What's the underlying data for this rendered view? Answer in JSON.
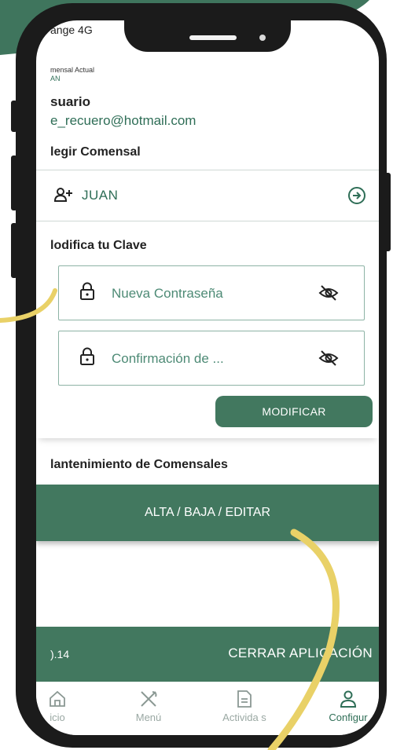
{
  "status": {
    "carrier": "ange  4G"
  },
  "header": {
    "comensal_actual_label": "mensal Actual",
    "comensal_actual_value": "AN"
  },
  "usuario": {
    "label": "suario",
    "email": "e_recuero@hotmail.com"
  },
  "elegir": {
    "title": "legir Comensal",
    "selected": "JUAN"
  },
  "clave": {
    "title": "lodifica tu Clave",
    "new_password_placeholder": "Nueva Contraseña",
    "confirm_placeholder": "Confirmación de ...",
    "modify_button": "MODIFICAR"
  },
  "mantenimiento": {
    "title": "lantenimiento de Comensales",
    "button": "ALTA / BAJA / EDITAR"
  },
  "footer": {
    "version": ").14",
    "close_button": "CERRAR APLICACIÓN"
  },
  "tabs": [
    {
      "label": "icio",
      "icon": "home-icon"
    },
    {
      "label": "Menú",
      "icon": "utensils-icon"
    },
    {
      "label": "Activida   s",
      "icon": "document-icon"
    },
    {
      "label": "Configur",
      "icon": "user-icon",
      "active": true
    }
  ],
  "colors": {
    "accent": "#42785f",
    "accent_text": "#2f6e57",
    "frame": "#1b1b1b",
    "highlight": "#e9d167"
  }
}
